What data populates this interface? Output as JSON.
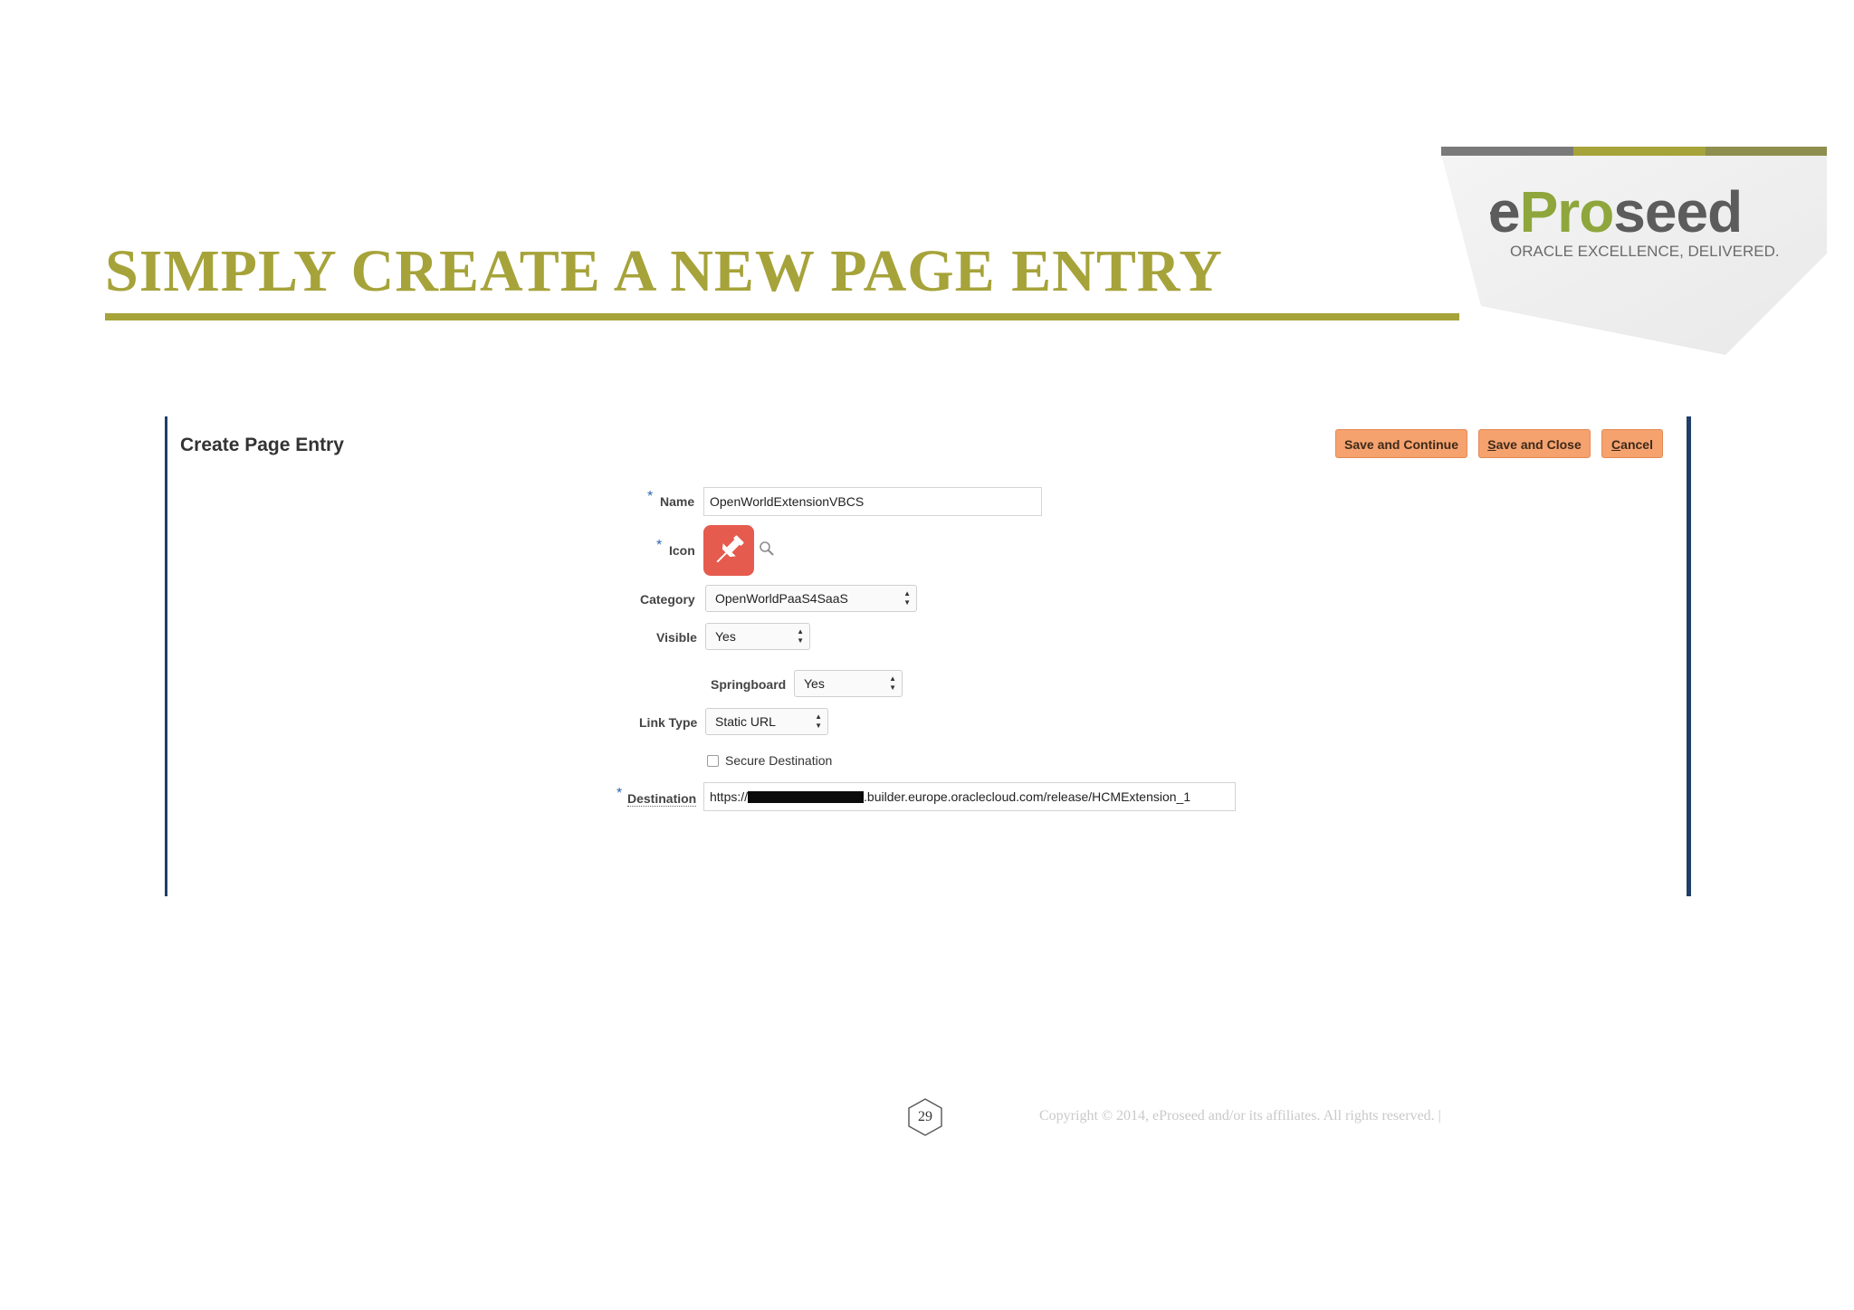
{
  "slide": {
    "title": "SIMPLY CREATE A NEW PAGE ENTRY",
    "accent_color": "#a6a33a",
    "frame_color": "#1f3f66"
  },
  "logo": {
    "word_prefix": "e",
    "word_mid": "Pro",
    "word_suffix": "seed",
    "tagline": "ORACLE EXCELLENCE, DELIVERED."
  },
  "panel": {
    "title": "Create Page Entry",
    "buttons": {
      "save_continue": "Save and Continue",
      "save_close_accel": "S",
      "save_close_rest": "ave and Close",
      "cancel_accel": "C",
      "cancel_rest": "ancel"
    },
    "button_color": "#f5a26f",
    "required_marker": "*",
    "fields": {
      "name_label": "Name",
      "name_value": "OpenWorldExtensionVBCS",
      "icon_label": "Icon",
      "icon_name": "pushpin-icon",
      "category_label": "Category",
      "category_value": "OpenWorldPaaS4SaaS",
      "visible_label": "Visible",
      "visible_value": "Yes",
      "springboard_label": "Springboard",
      "springboard_value": "Yes",
      "link_type_label": "Link Type",
      "link_type_value": "Static URL",
      "secure_label": "Secure Destination",
      "secure_checked": false,
      "destination_label": "Destination",
      "destination_prefix": "https://",
      "destination_suffix": ".builder.europe.oraclecloud.com/release/HCMExtension_1"
    },
    "select_arrows": "▲▼"
  },
  "footer": {
    "page_number": "29",
    "copyright": "Copyright © 2014, eProseed and/or its affiliates. All rights reserved.  |"
  }
}
